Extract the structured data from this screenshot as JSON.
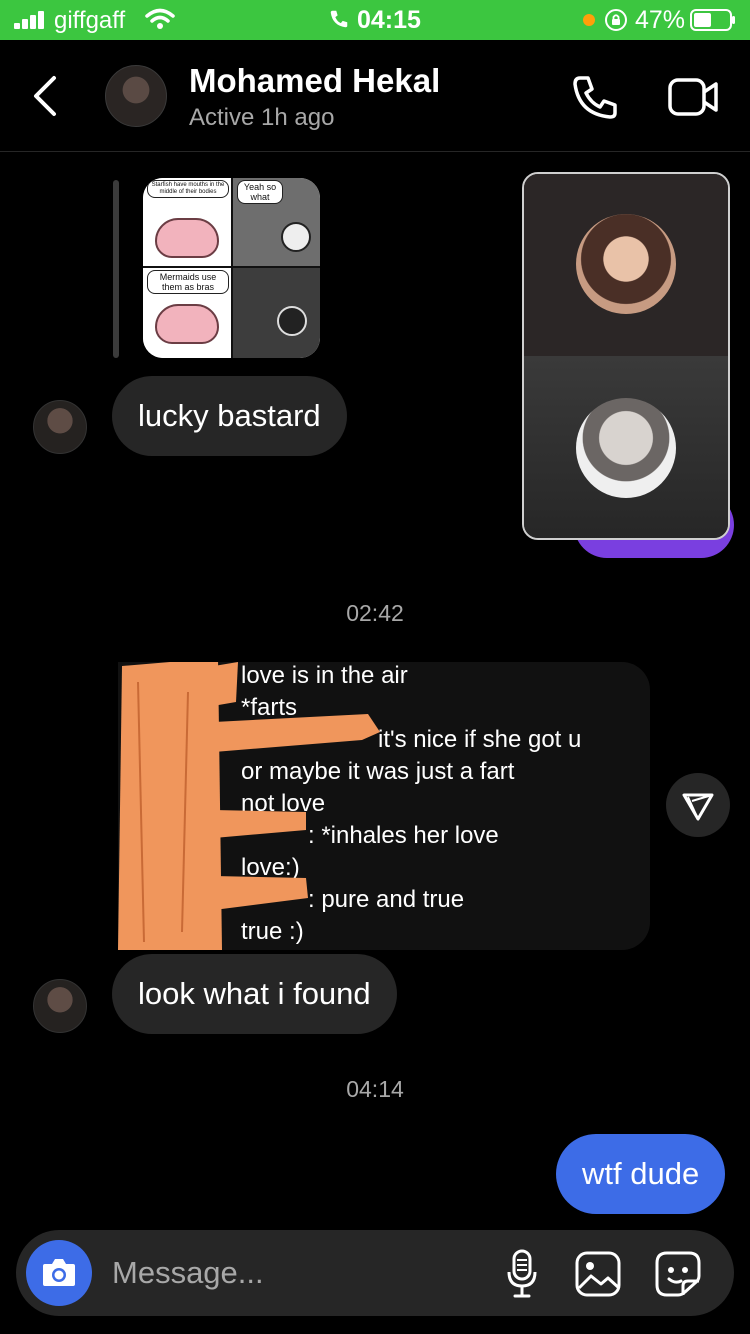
{
  "status_bar": {
    "carrier": "giffgaff",
    "time": "04:15",
    "battery": "47%",
    "icons": [
      "signal-icon",
      "wifi-icon",
      "call-active-icon",
      "orientation-lock-icon",
      "battery-icon"
    ]
  },
  "header": {
    "name": "Mohamed Hekal",
    "status": "Active 1h ago",
    "icons": [
      "back-chevron-icon",
      "phone-icon",
      "video-camera-icon"
    ]
  },
  "messages": {
    "received_1": "lucky bastard",
    "received_2": "look what i found",
    "sent_1": "wtf dude"
  },
  "meme": {
    "panel_1": "Starfish have mouths in the middle of their bodies",
    "panel_2": "Yeah so what",
    "panel_3": "Mermaids use them as bras"
  },
  "timestamps": {
    "t1": "02:42",
    "t2": "04:14"
  },
  "screenshot_message": {
    "lines": [
      "love is in the air",
      "*farts",
      "it's nice if she got u",
      "or maybe it was just a fart",
      "not love",
      ": *inhales her love",
      "love:)",
      ": pure and true",
      "true :)"
    ]
  },
  "composer": {
    "placeholder": "Message...",
    "icons": [
      "camera-icon",
      "microphone-icon",
      "gallery-icon",
      "sticker-icon"
    ]
  },
  "colors": {
    "status_bar": "#3cc640",
    "sent_bubble": "#3d6ce7",
    "received_bubble": "#262626",
    "redaction": "#f0965c",
    "purple_bubble": "#7a3fe0"
  }
}
